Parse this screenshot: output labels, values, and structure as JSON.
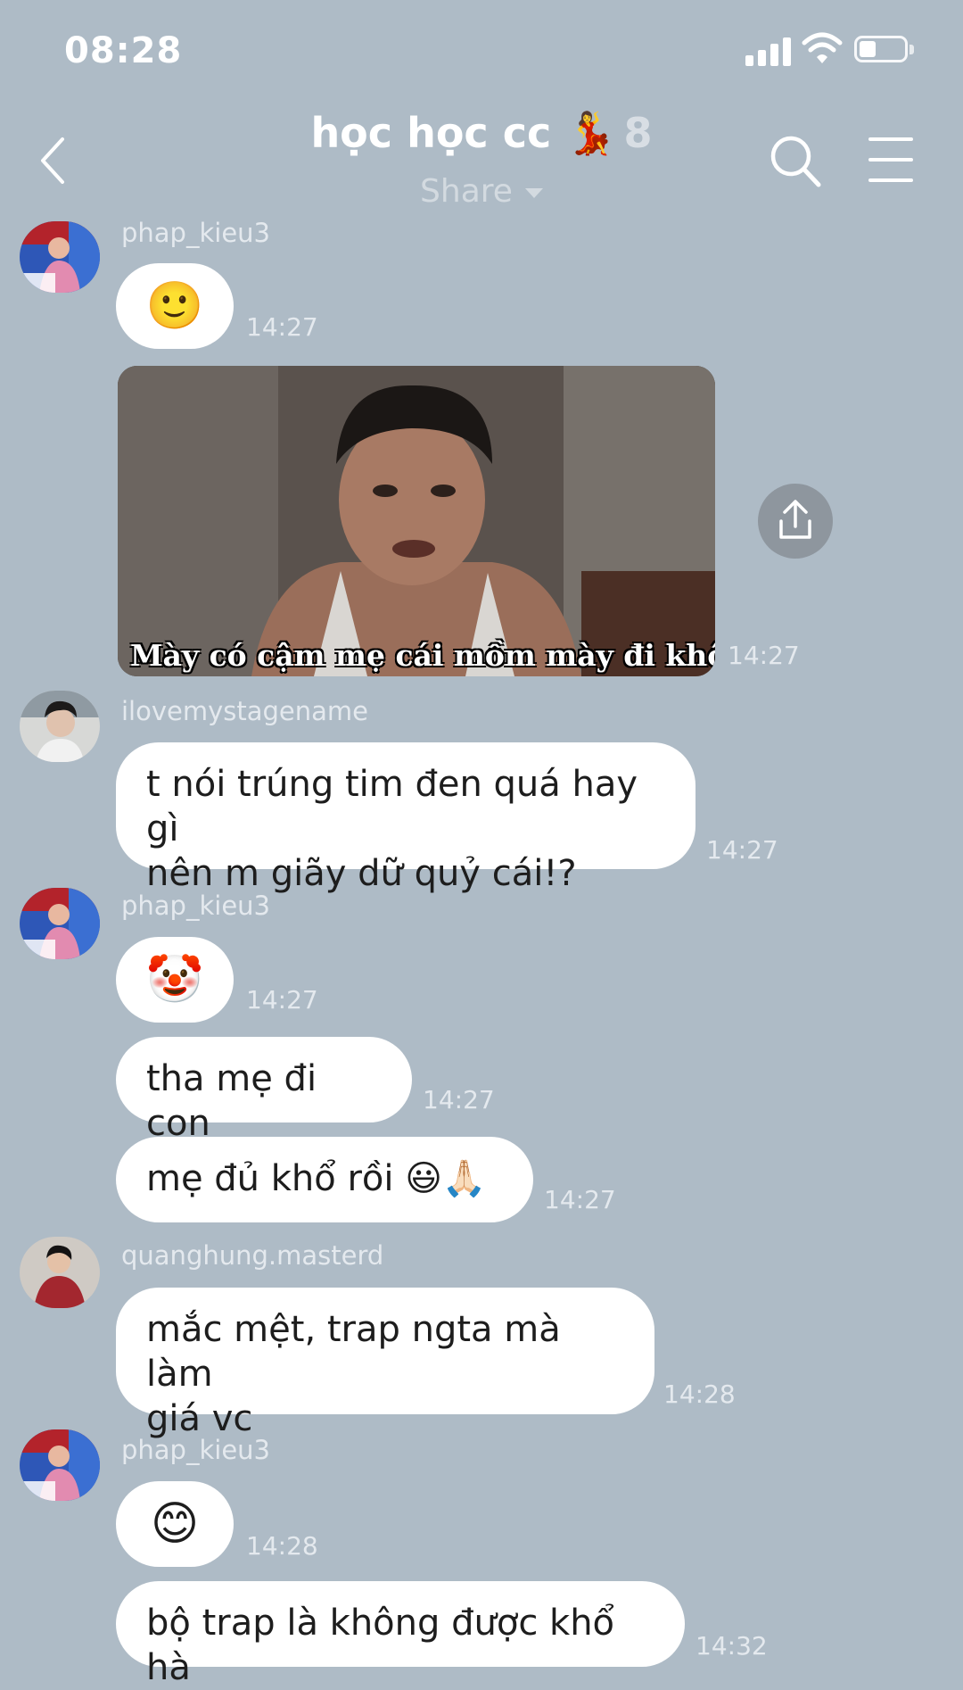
{
  "status_bar": {
    "time": "08:28",
    "battery_level": 0.3
  },
  "header": {
    "title": "học học cc 💃",
    "member_count": "8",
    "share_label": "Share"
  },
  "messages": [
    {
      "sender": "phap_kieu3",
      "content": "🙂",
      "time": "14:27"
    },
    {
      "image_caption": "Mày có cậm mẹ cái mồm mày đi không",
      "time": "14:27"
    },
    {
      "sender": "ilovemystagename",
      "line1": "t nói trúng tim đen quá hay gì",
      "line2": "nên m giãy dữ quỷ cái!?",
      "time": "14:27"
    },
    {
      "sender": "phap_kieu3",
      "content": "🤡",
      "time": "14:27"
    },
    {
      "content": "tha mẹ đi con",
      "time": "14:27"
    },
    {
      "content": "mẹ đủ khổ rồi 😃🙏🏻",
      "time": "14:27"
    },
    {
      "sender": "quanghung.masterd",
      "line1": "mắc mệt, trap ngta mà làm",
      "line2": "giá vc",
      "time": "14:28"
    },
    {
      "sender": "phap_kieu3",
      "content": "😊",
      "time": "14:28"
    },
    {
      "content": "bộ trap là không được khổ hà",
      "time": "14:32"
    }
  ],
  "colors": {
    "background": "#aebbc6",
    "bubble": "#ffffff",
    "header_text": "#ffffff",
    "muted_text": "#e4e9ee"
  },
  "icons": [
    "back-icon",
    "search-icon",
    "menu-icon",
    "share-icon",
    "signal-icon",
    "wifi-icon",
    "battery-icon"
  ]
}
